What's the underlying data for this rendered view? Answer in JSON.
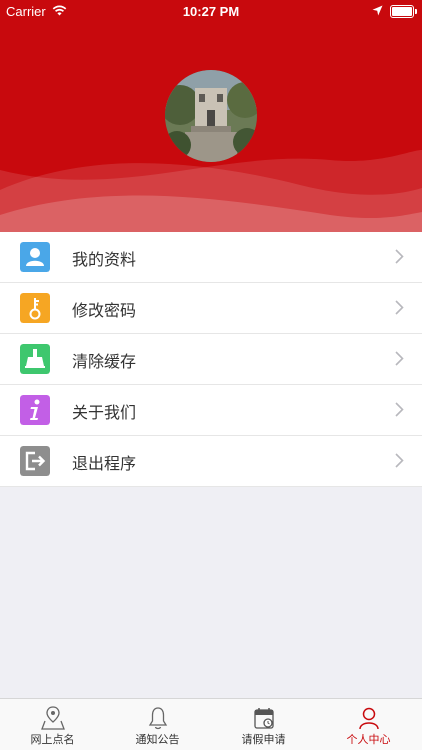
{
  "status_bar": {
    "carrier": "Carrier",
    "time": "10:27 PM"
  },
  "header": {
    "avatar": "campus-building-photo"
  },
  "menu": {
    "items": [
      {
        "label": "我的资料",
        "icon": "user-card-icon",
        "color": "#4aa7e8"
      },
      {
        "label": "修改密码",
        "icon": "key-icon",
        "color": "#f6a623"
      },
      {
        "label": "清除缓存",
        "icon": "broom-icon",
        "color": "#3ec76e"
      },
      {
        "label": "关于我们",
        "icon": "info-icon",
        "color": "#c25fe6"
      },
      {
        "label": "退出程序",
        "icon": "logout-icon",
        "color": "#8e8e8e"
      }
    ]
  },
  "tabs": [
    {
      "label": "网上点名",
      "icon": "map-pin-icon"
    },
    {
      "label": "通知公告",
      "icon": "bell-icon"
    },
    {
      "label": "请假申请",
      "icon": "calendar-icon"
    },
    {
      "label": "个人中心",
      "icon": "person-icon",
      "active": true
    }
  ],
  "theme": {
    "primary": "#c8090d"
  }
}
